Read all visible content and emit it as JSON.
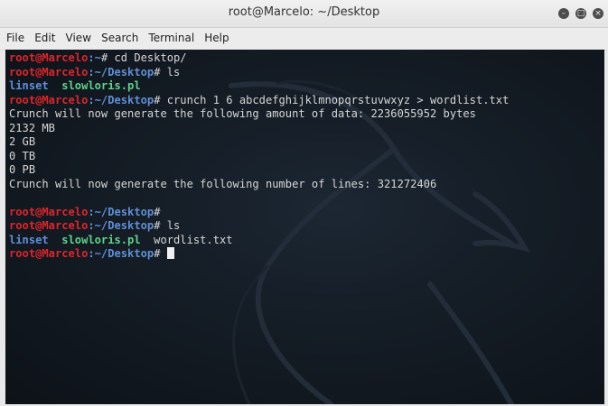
{
  "window": {
    "title": "root@Marcelo: ~/Desktop",
    "buttons": [
      "minimize",
      "maximize",
      "close"
    ]
  },
  "menu": [
    "File",
    "Edit",
    "View",
    "Search",
    "Terminal",
    "Help"
  ],
  "terminal": {
    "colors": {
      "user": "#e0252a",
      "path": "#5f8fd6",
      "text": "#d6d6d6",
      "file": "#5fd38d"
    },
    "lines": [
      {
        "segs": [
          {
            "t": "root@Marcelo",
            "c": "u"
          },
          {
            "t": ":~",
            "c": "p"
          },
          {
            "t": "# cd Desktop/",
            "c": "w"
          }
        ]
      },
      {
        "segs": [
          {
            "t": "root@Marcelo",
            "c": "u"
          },
          {
            "t": ":~/Desktop",
            "c": "p"
          },
          {
            "t": "# ls",
            "c": "w"
          }
        ]
      },
      {
        "segs": [
          {
            "t": "linset  ",
            "c": "p"
          },
          {
            "t": "slowloris.pl",
            "c": "g"
          }
        ]
      },
      {
        "segs": [
          {
            "t": "root@Marcelo",
            "c": "u"
          },
          {
            "t": ":~/Desktop",
            "c": "p"
          },
          {
            "t": "# crunch 1 6 abcdefghijklmnopqrstuvwxyz > wordlist.txt",
            "c": "w"
          }
        ]
      },
      {
        "segs": [
          {
            "t": "Crunch will now generate the following amount of data: 2236055952 bytes",
            "c": "w"
          }
        ]
      },
      {
        "segs": [
          {
            "t": "2132 MB",
            "c": "w"
          }
        ]
      },
      {
        "segs": [
          {
            "t": "2 GB",
            "c": "w"
          }
        ]
      },
      {
        "segs": [
          {
            "t": "0 TB",
            "c": "w"
          }
        ]
      },
      {
        "segs": [
          {
            "t": "0 PB",
            "c": "w"
          }
        ]
      },
      {
        "segs": [
          {
            "t": "Crunch will now generate the following number of lines: 321272406",
            "c": "w"
          }
        ]
      },
      {
        "segs": []
      },
      {
        "segs": [
          {
            "t": "root@Marcelo",
            "c": "u"
          },
          {
            "t": ":~/Desktop",
            "c": "p"
          },
          {
            "t": "#",
            "c": "w"
          }
        ]
      },
      {
        "segs": [
          {
            "t": "root@Marcelo",
            "c": "u"
          },
          {
            "t": ":~/Desktop",
            "c": "p"
          },
          {
            "t": "# ls",
            "c": "w"
          }
        ]
      },
      {
        "segs": [
          {
            "t": "linset  ",
            "c": "p"
          },
          {
            "t": "slowloris.pl",
            "c": "g"
          },
          {
            "t": "  wordlist.txt",
            "c": "w"
          }
        ]
      },
      {
        "segs": [
          {
            "t": "root@Marcelo",
            "c": "u"
          },
          {
            "t": ":~/Desktop",
            "c": "p"
          },
          {
            "t": "# ",
            "c": "w"
          }
        ],
        "cursor": true
      }
    ]
  }
}
